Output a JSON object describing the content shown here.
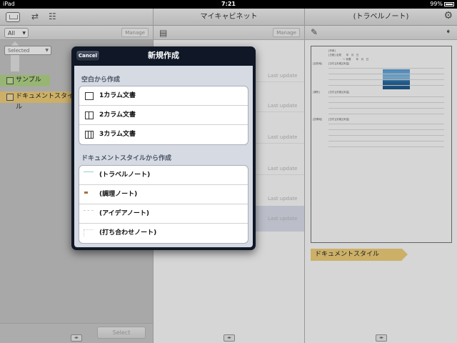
{
  "status": {
    "device": "iPad",
    "time": "7:21",
    "battery": "99%"
  },
  "left_pane": {
    "filter": "All",
    "manage": "Manage",
    "selected_filter": "Selected",
    "folders": [
      {
        "label": "サンプル"
      },
      {
        "label": "ドキュメントスタイル"
      }
    ],
    "select_button": "Select"
  },
  "middle_pane": {
    "title": "マイキャビネット",
    "manage": "Manage",
    "last_update_label": "Last update"
  },
  "right_pane": {
    "title": "(トラベルノート)",
    "preview_texts": [
      "[作家]",
      "[日程] 出発　　年　月　日",
      "〜 到着　　年　月　日",
      "[目的地]",
      "[場所]",
      "[訪問地]",
      "[日付][天候][気温]"
    ],
    "folder_tag": "ドキュメントスタイル"
  },
  "popover": {
    "title": "新規作成",
    "cancel": "Cancel",
    "section_blank": "空白から作成",
    "blank_items": [
      {
        "label": "1カラム文書"
      },
      {
        "label": "2カラム文書"
      },
      {
        "label": "3カラム文書"
      }
    ],
    "section_style": "ドキュメントスタイルから作成",
    "style_items": [
      {
        "label": "(トラベルノート)"
      },
      {
        "label": "(調理ノート)"
      },
      {
        "label": "(アイデアノート)"
      },
      {
        "label": "(打ち合わせノート)"
      }
    ]
  }
}
